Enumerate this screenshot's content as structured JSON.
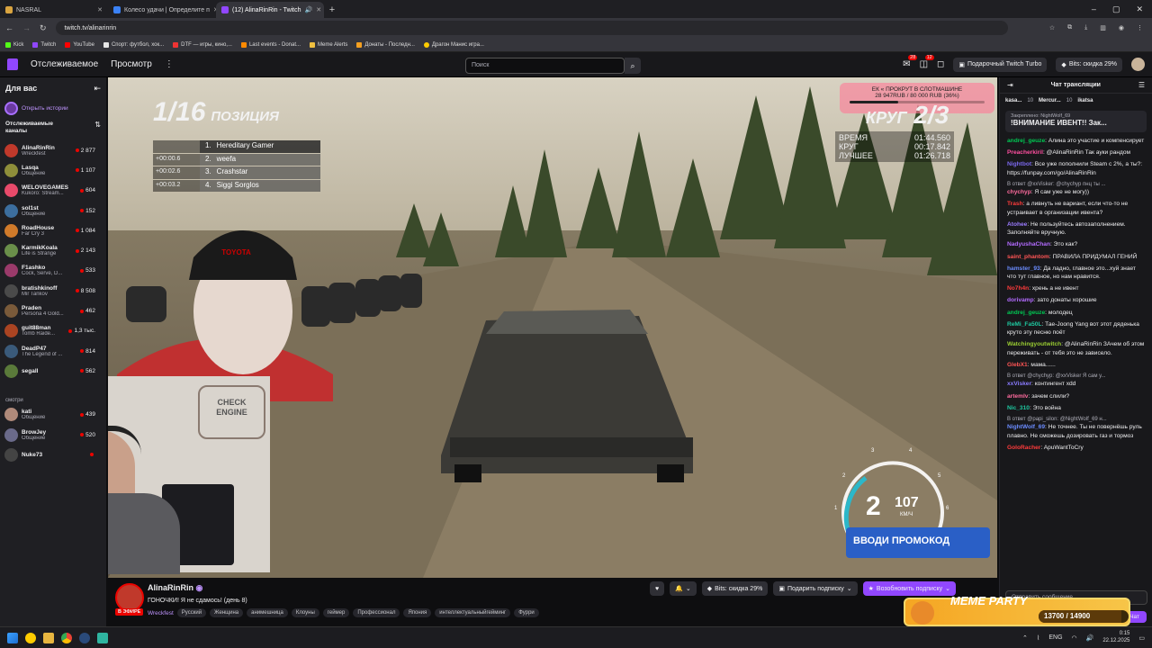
{
  "browser": {
    "tabs": [
      {
        "label": "NASRAL",
        "active": false
      },
      {
        "label": "Колесо удачи | Определите п",
        "active": false
      },
      {
        "label": "(12) AlinaRinRin - Twitch",
        "active": true
      }
    ],
    "url": "twitch.tv/alinarinrin",
    "bookmarks": [
      "Kick",
      "Twitch",
      "YouTube",
      "Спорт: футбол, хок...",
      "DTF — игры, кино,...",
      "Last events - Donat...",
      "Meme Alerts",
      "Донаты - Последн...",
      "Драгон Манис игра..."
    ]
  },
  "nav": {
    "following": "Отслеживаемое",
    "browse": "Просмотр",
    "search_placeholder": "Поиск",
    "notif_count_1": "28",
    "notif_count_2": "12",
    "turbo": "Подарочный Twitch Turbo",
    "bits": "Bits: скидка 29%"
  },
  "sidebar": {
    "for_you": "Для вас",
    "open_stories": "Открыть истории",
    "followed_title_1": "Отслеживаемые",
    "followed_title_2": "каналы",
    "channels": [
      {
        "name": "AlinaRinRin",
        "game": "Wreckfest",
        "viewers": "2 877",
        "color": "#c0392b"
      },
      {
        "name": "Lasqa",
        "game": "Общение",
        "viewers": "1 107",
        "color": "#8e8e3a"
      },
      {
        "name": "WELOVEGAMES",
        "game": "Kukoro: Stream...",
        "viewers": "604",
        "color": "#e84a6a"
      },
      {
        "name": "sol1st",
        "game": "Общение",
        "viewers": "152",
        "color": "#3c6e9e"
      },
      {
        "name": "RoadHouse",
        "game": "Far Cry 3",
        "viewers": "1 084",
        "color": "#d07a2a"
      },
      {
        "name": "KarmikKoala",
        "game": "Life is Strange",
        "viewers": "2 143",
        "color": "#6a8f4a"
      },
      {
        "name": "F1ashko",
        "game": "Cock, Serve, D...",
        "viewers": "533",
        "color": "#9a3a6a"
      },
      {
        "name": "bratishkinoff",
        "game": "Mir Tankov",
        "viewers": "8 508",
        "color": "#4a4a4a"
      },
      {
        "name": "Praden",
        "game": "Persona 4 Gold...",
        "viewers": "462",
        "color": "#7a5a3a"
      },
      {
        "name": "guit88man",
        "game": "Tomb Raide...",
        "viewers": "1,3 тыс.",
        "color": "#aa4422"
      },
      {
        "name": "DeadP47",
        "game": "The Legend of ...",
        "viewers": "814",
        "color": "#3a5a7a"
      },
      {
        "name": "segall",
        "game": "",
        "viewers": "562",
        "color": "#5a7a3a"
      }
    ],
    "section_label": "смотри",
    "channels_bottom": [
      {
        "name": "kati",
        "game": "Общение",
        "viewers": "439",
        "color": "#b08a7a"
      },
      {
        "name": "BrowJey",
        "game": "Общение",
        "viewers": "520",
        "color": "#6a6a8a"
      },
      {
        "name": "Nuke73",
        "game": "",
        "viewers": "",
        "color": "#444"
      }
    ]
  },
  "overlay": {
    "position_num": "1/16",
    "position_word": "ПОЗИЦИЯ",
    "leaderboard": [
      {
        "gap": "",
        "pos": "1.",
        "name": "Hereditary Gamer"
      },
      {
        "gap": "+00:00.6",
        "pos": "2.",
        "name": "weefa"
      },
      {
        "gap": "+00:02.6",
        "pos": "3.",
        "name": "Crashstar"
      },
      {
        "gap": "+00:03.2",
        "pos": "4.",
        "name": "Siggi Sorglos"
      }
    ],
    "slot_banner": "ЕК « ПРОКРУТ В СЛОТМАШИНЕ",
    "slot_progress": "28 947RUB / 80 000 RUB (36%)",
    "slot_fraction": 0.36,
    "lap": "2/3",
    "lap_word": "КРУГ",
    "time_label": "ВРЕМЯ",
    "time_value": "01:44.560",
    "lap_label": "КРУГ",
    "lap_value": "00:17.842",
    "best_label": "ЛУЧШЕЕ",
    "best_value": "01:26.718",
    "gear": "2",
    "speed": "107",
    "speed_unit": "КМ/Ч",
    "tach": [
      "1",
      "2",
      "3",
      "4",
      "5",
      "6"
    ],
    "promo": "ВВОДИ ПРОМОКОД",
    "cap_logo": "TOYOTA",
    "poster_text_1": "CHECK",
    "poster_text_2": "ENGINE"
  },
  "stream": {
    "channel": "AlinaRinRin",
    "live": "В ЭФИРЕ",
    "title": "ГОНОЧКИ! Я не сдамось! (день 8)",
    "game": "Wreckfest",
    "tags": [
      "Русский",
      "Женщина",
      "анимешница",
      "Клоуны",
      "геймер",
      "Профессионал",
      "Япония",
      "интеллектуальныйгейминг",
      "Фурри"
    ],
    "bits_btn": "Bits: скидка 29%",
    "gift_btn": "Подарить подписку",
    "resub_btn": "Возобновить подписку"
  },
  "chat": {
    "header": "Чат трансляции",
    "pinned_by": "Закреплено: NightWolf_69",
    "pinned_text": "!ВНИМАНИЕ ИВЕНТ!! Зак...",
    "top_users": [
      {
        "name": "kasa...",
        "count": ""
      },
      {
        "name": "",
        "count": "10"
      },
      {
        "name": "Mercur...",
        "count": ""
      },
      {
        "name": "",
        "count": "10"
      },
      {
        "name": "ikatsa",
        "count": ""
      }
    ],
    "messages": [
      {
        "reply": "",
        "user": "andrej_geuze",
        "color": "#00c853",
        "text": "Алина это участие и компенсирует"
      },
      {
        "reply": "",
        "user": "Preacherkiril",
        "color": "#ff4fa0",
        "text": "@AlinaRinRin Так ауки рандом"
      },
      {
        "reply": "",
        "user": "Nightbot",
        "color": "#7b68ee",
        "text": "Все уже пополнили Steam с 2%, а ты?: https://funpay.com/go/AlinaRinRin"
      },
      {
        "reply": "В ответ @xxVisker: @chychyp пнц ты ...",
        "user": "chychyp",
        "color": "#ff6b9e",
        "text": "Я сам уже не могу))"
      },
      {
        "reply": "",
        "user": "Trash",
        "color": "#ff3b3b",
        "text": "а ливнуть не вариант, если что-то не устраивает в организации ивента?"
      },
      {
        "reply": "",
        "user": "Atohee",
        "color": "#9b7bff",
        "text": "Не пользуйтесь автозаполнением. Заполняйте вручную."
      },
      {
        "reply": "",
        "user": "NadyushaChan",
        "color": "#b36bff",
        "text": "Это как?"
      },
      {
        "reply": "",
        "user": "saint_phantom",
        "color": "#ff5555",
        "text": "ПРАВИЛА ПРИДУМАЛ ГЕНИЙ"
      },
      {
        "reply": "",
        "user": "hamster_93",
        "color": "#6b8cff",
        "text": "Да ладно, главное это...хуй знает что тут главное, но нам нравится."
      },
      {
        "reply": "",
        "user": "No7h4n",
        "color": "#ff3b3b",
        "text": "хрень а не ивент"
      },
      {
        "reply": "",
        "user": "dorivamp",
        "color": "#b36bff",
        "text": "зато донаты хорошие"
      },
      {
        "reply": "",
        "user": "andrej_geuze",
        "color": "#00c853",
        "text": "молодец"
      },
      {
        "reply": "",
        "user": "ReMi_Fa50L",
        "color": "#1ec8a0",
        "text": "Тае-Joong Yang вот этот дяденька круто эту песню поёт"
      },
      {
        "reply": "",
        "user": "Watchingyoutwitch",
        "color": "#9acd32",
        "text": "@AlinaRinRin ЗАчем об этом переживать - от тебя это не зависело."
      },
      {
        "reply": "",
        "user": "GlebX1",
        "color": "#ff5555",
        "text": "мама......"
      },
      {
        "reply": "В ответ @chychyp: @xxVisker Я сам у...",
        "user": "xxVisker",
        "color": "#8a7bff",
        "text": "контингент xdd"
      },
      {
        "reply": "",
        "user": "artemlv",
        "color": "#ff6b9e",
        "text": "зачем слили?"
      },
      {
        "reply": "",
        "user": "Nic_310",
        "color": "#1ec8a0",
        "text": "Это война"
      },
      {
        "reply": "В ответ @papi_silon: @NightWolf_69 н...",
        "user": "NightWolf_69",
        "color": "#6b8cff",
        "text": "Не точнее. Ты не повернёшь руль плавно. Не сможешь дозировать газ и тормоз"
      },
      {
        "reply": "",
        "user": "GoloRacher",
        "color": "#ff3b3b",
        "text": "ApuWantToCry"
      }
    ],
    "input_placeholder": "Отправить сообщение",
    "chat_btn": "Чат"
  },
  "meme": {
    "title": "MEME PARTY",
    "progress": "13700 / 14900",
    "fraction": 0.92
  },
  "taskbar": {
    "lang": "ENG",
    "time": "0:15",
    "date": "22.12.2025"
  }
}
